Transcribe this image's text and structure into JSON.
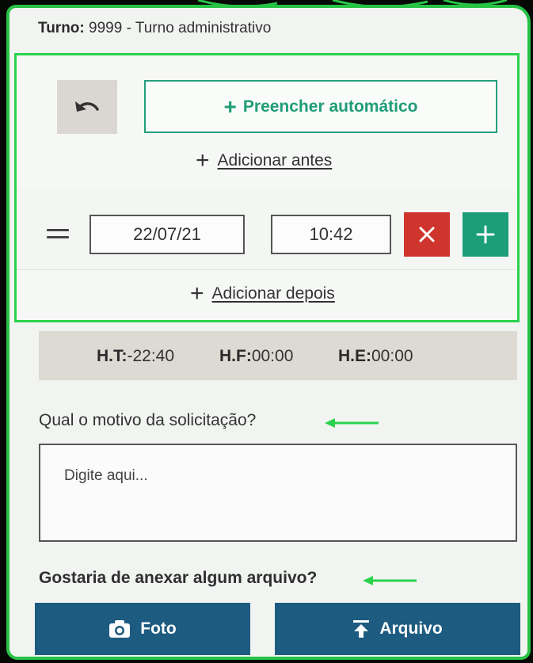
{
  "shift": {
    "label": "Turno:",
    "value": "9999 - Turno administrativo"
  },
  "entry": {
    "undo_icon": "undo-icon",
    "auto_fill_label": "Preencher automático",
    "add_before_label": "Adicionar antes",
    "add_after_label": "Adicionar depois",
    "row": {
      "date": "22/07/21",
      "time": "10:42"
    },
    "plus_glyph": "+"
  },
  "hours": [
    {
      "label": "H.T:",
      "value": "-22:40"
    },
    {
      "label": "H.F:",
      "value": "00:00"
    },
    {
      "label": "H.E:",
      "value": "00:00"
    }
  ],
  "reason": {
    "question": "Qual o motivo da solicitação?",
    "placeholder": "Digite aqui..."
  },
  "attachment": {
    "question": "Gostaria de anexar algum arquivo?",
    "photo_label": "Foto",
    "file_label": "Arquivo"
  },
  "colors": {
    "accent_green": "#1f9d77",
    "highlight_green": "#2bd24c",
    "danger_red": "#d0352d",
    "primary_blue": "#1d5b80",
    "summary_bg": "#ddd9d3"
  }
}
